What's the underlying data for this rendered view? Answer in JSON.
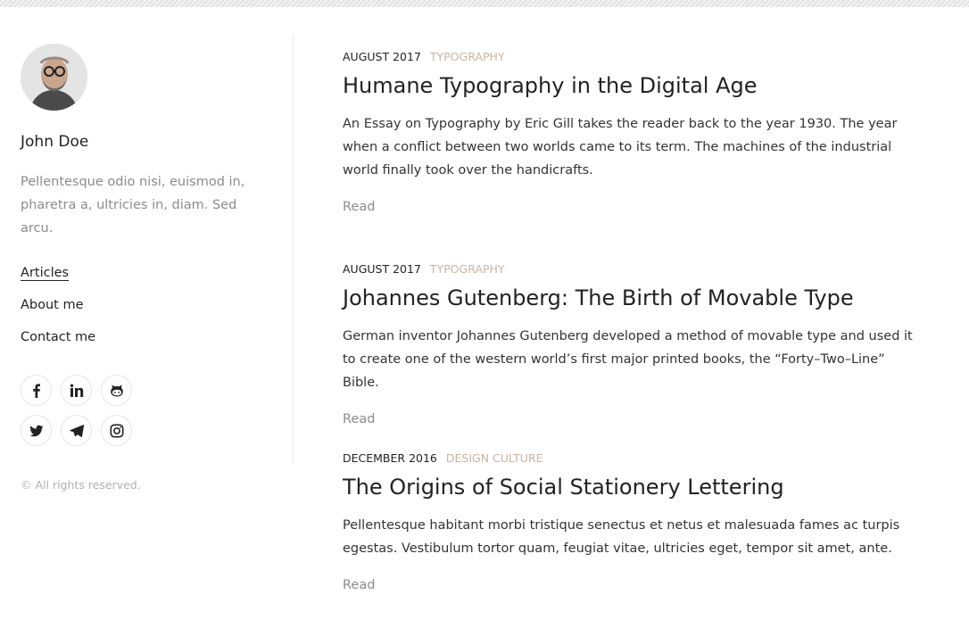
{
  "sidebar": {
    "author_name": "John Doe",
    "bio": "Pellentesque odio nisi, euismod in, pharetra a, ultricies in, diam. Sed arcu.",
    "menu": [
      {
        "label": "Articles",
        "active": true
      },
      {
        "label": "About me",
        "active": false
      },
      {
        "label": "Contact me",
        "active": false
      }
    ],
    "social_icons": [
      "facebook-icon",
      "linkedin-icon",
      "github-icon",
      "twitter-icon",
      "telegram-icon",
      "instagram-icon"
    ],
    "copyright": "© All rights reserved."
  },
  "posts": [
    {
      "date": "August 2017",
      "category": "Typography",
      "title": "Humane Typography in the Digital Age",
      "excerpt": "An Essay on Typography by Eric Gill takes the reader back to the year 1930. The year when a conflict between two worlds came to its term. The machines of the industrial world finally took over the handicrafts.",
      "read_label": "Read"
    },
    {
      "date": "August 2017",
      "category": "Typography",
      "title": "Johannes Gutenberg: The Birth of Movable Type",
      "excerpt": "German inventor Johannes Gutenberg developed a method of movable type and used it to create one of the western world’s first major printed books, the “Forty–Two–Line” Bible.",
      "read_label": "Read"
    },
    {
      "date": "December 2016",
      "category": "Design Culture",
      "title": "The Origins of Social Stationery Lettering",
      "excerpt": "Pellentesque habitant morbi tristique senectus et netus et malesuada fames ac turpis egestas. Vestibulum tortor quam, feugiat vitae, ultricies eget, tempor sit amet, ante.",
      "read_label": "Read"
    }
  ],
  "colors": {
    "accent_category": "#c8b49e",
    "muted_text": "#8b8b8b",
    "text": "#222222"
  }
}
